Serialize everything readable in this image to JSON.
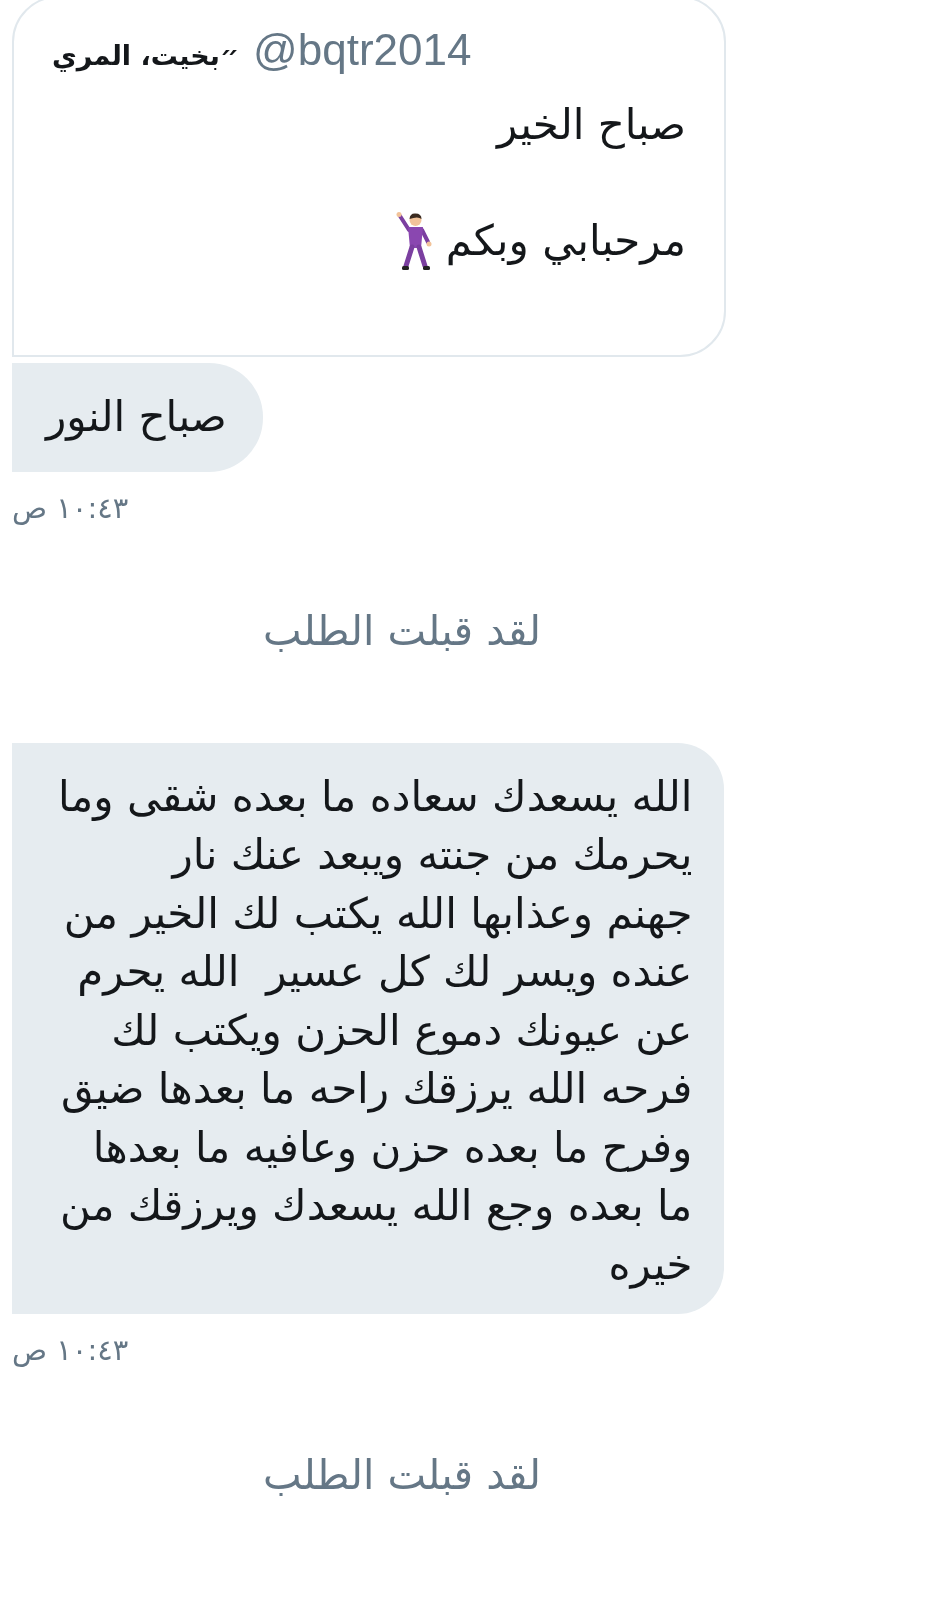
{
  "conversation": {
    "items": [
      {
        "kind": "message",
        "shared_tweet": {
          "author_name": "״بخيت، المري",
          "author_handle": "@bqtr2014",
          "lines": [
            "صباح الخير",
            "مرحبابي وبكم"
          ]
        },
        "text": "صباح النور",
        "time": "١٠:٤٣ ص"
      },
      {
        "kind": "notice",
        "text": "لقد قبلت الطلب"
      },
      {
        "kind": "message",
        "text": "الله يسعدك سعاده ما بعده شقى وما\nيحرمك من جنته ويبعد عنك نار\nجهنم وعذابها الله يكتب لك الخير من\nعنده ويسر لك كل عسير  الله يحرم\nعن عيونك دموع الحزن ويكتب لك\nفرحه الله يرزقك راحه ما بعدها ضيق\nوفرح ما بعده حزن وعافيه ما بعدها\nما بعده وجع الله يسعدك ويرزقك من\nخيره",
        "time": "١٠:٤٣ ص"
      },
      {
        "kind": "notice",
        "text": "لقد قبلت الطلب"
      }
    ]
  }
}
